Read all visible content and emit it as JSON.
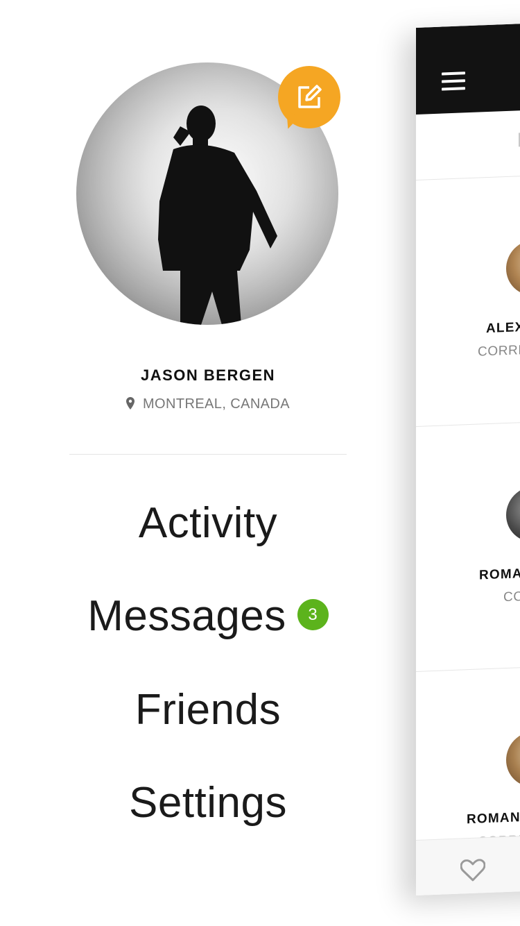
{
  "profile": {
    "name": "JASON BERGEN",
    "location": "MONTREAL, CANADA"
  },
  "menu": {
    "activity": "Activity",
    "messages": "Messages",
    "messages_badge": "3",
    "friends": "Friends",
    "settings": "Settings"
  },
  "feed": {
    "cards": [
      {
        "name": "ALEX",
        "subtitle": "CORRE"
      },
      {
        "name": "ROMA",
        "subtitle": "CO"
      },
      {
        "name": "ROMAN",
        "subtitle": "CORRE"
      }
    ]
  },
  "colors": {
    "accent_orange": "#f5a623",
    "badge_green": "#5cb31c",
    "topbar": "#121212"
  },
  "icons": {
    "edit": "edit-icon",
    "location": "location-pin-icon",
    "menu": "hamburger-menu-icon",
    "like": "heart-icon"
  }
}
